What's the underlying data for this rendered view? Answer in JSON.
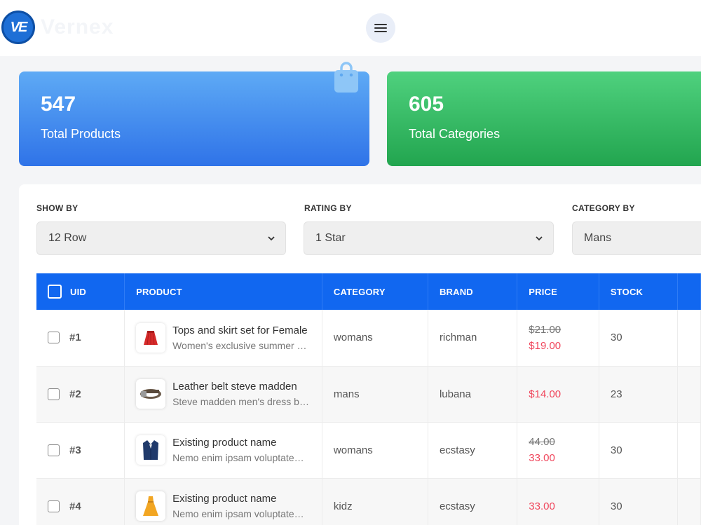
{
  "header": {
    "logo_initials": "VE",
    "logo_text": "Vernex"
  },
  "stats": [
    {
      "value": "547",
      "label": "Total Products"
    },
    {
      "value": "605",
      "label": "Total Categories"
    }
  ],
  "filters": {
    "show_by": {
      "label": "SHOW BY",
      "value": "12 Row"
    },
    "rating_by": {
      "label": "RATING BY",
      "value": "1 Star"
    },
    "category_by": {
      "label": "CATEGORY BY",
      "value": "Mans"
    }
  },
  "table": {
    "headers": [
      "UID",
      "PRODUCT",
      "CATEGORY",
      "BRAND",
      "PRICE",
      "STOCK"
    ],
    "rows": [
      {
        "uid": "#1",
        "name": "Tops and skirt set for Female",
        "desc": "Women's exclusive summer collection",
        "category": "womans",
        "brand": "richman",
        "old_price": "$21.00",
        "price": "$19.00",
        "stock": "30",
        "thumb": "skirt-icon"
      },
      {
        "uid": "#2",
        "name": "Leather belt steve madden",
        "desc": "Steve madden men's dress belt",
        "category": "mans",
        "brand": "lubana",
        "old_price": "",
        "price": "$14.00",
        "stock": "23",
        "thumb": "belt-icon"
      },
      {
        "uid": "#3",
        "name": "Existing product name",
        "desc": "Nemo enim ipsam voluptatem quia",
        "category": "womans",
        "brand": "ecstasy",
        "old_price": "44.00",
        "price": "33.00",
        "stock": "30",
        "thumb": "blazer-icon"
      },
      {
        "uid": "#4",
        "name": "Existing product name",
        "desc": "Nemo enim ipsam voluptatem quia",
        "category": "kidz",
        "brand": "ecstasy",
        "old_price": "",
        "price": "33.00",
        "stock": "30",
        "thumb": "dress-icon"
      }
    ]
  },
  "colors": {
    "blue_card": "#2f73e8",
    "green_card": "#22a54f",
    "table_header": "#1167f0",
    "price_red": "#f0465c"
  }
}
